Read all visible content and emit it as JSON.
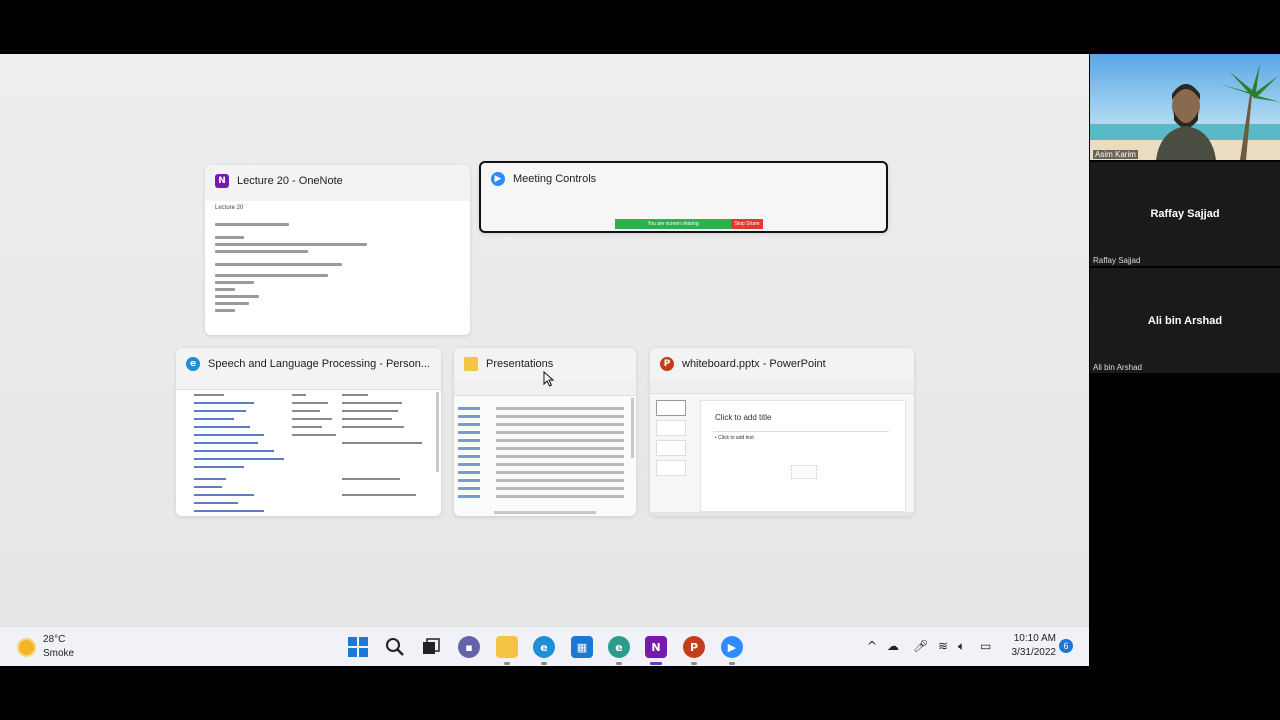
{
  "windows": {
    "onenote": {
      "title": "Lecture 20 - OneNote",
      "page_title": "Lecture 20",
      "icon": "onenote-icon"
    },
    "meeting": {
      "title": "Meeting Controls",
      "share_status": "You are screen sharing",
      "stop_share": "Stop Share",
      "icon": "zoom-icon"
    },
    "speech": {
      "title": "Speech and Language Processing - Person...",
      "icon": "edge-icon"
    },
    "explorer": {
      "title": "Presentations",
      "icon": "folder-icon"
    },
    "powerpoint": {
      "title": "whiteboard.pptx - PowerPoint",
      "slide_title": "Click to add title",
      "slide_text": "• Click to add text",
      "icon": "powerpoint-icon"
    }
  },
  "participants": [
    {
      "name_label": "Asim Karim"
    },
    {
      "name": "Raffay Sajjad",
      "name_label": "Raffay Sajjad"
    },
    {
      "name": "Ali bin Arshad",
      "name_label": "Ali bin Arshad"
    }
  ],
  "taskbar": {
    "weather_temp": "28°C",
    "weather_desc": "Smoke",
    "time": "10:10 AM",
    "date": "3/31/2022",
    "notification_count": "6"
  },
  "colors": {
    "onenote": "#7719aa",
    "zoom": "#2d8cff",
    "powerpoint": "#c43e1c",
    "folder": "#f4c542",
    "edge": "#1f8fd6",
    "stop_share": "#e23b2e",
    "share_green": "#2bb24c"
  }
}
